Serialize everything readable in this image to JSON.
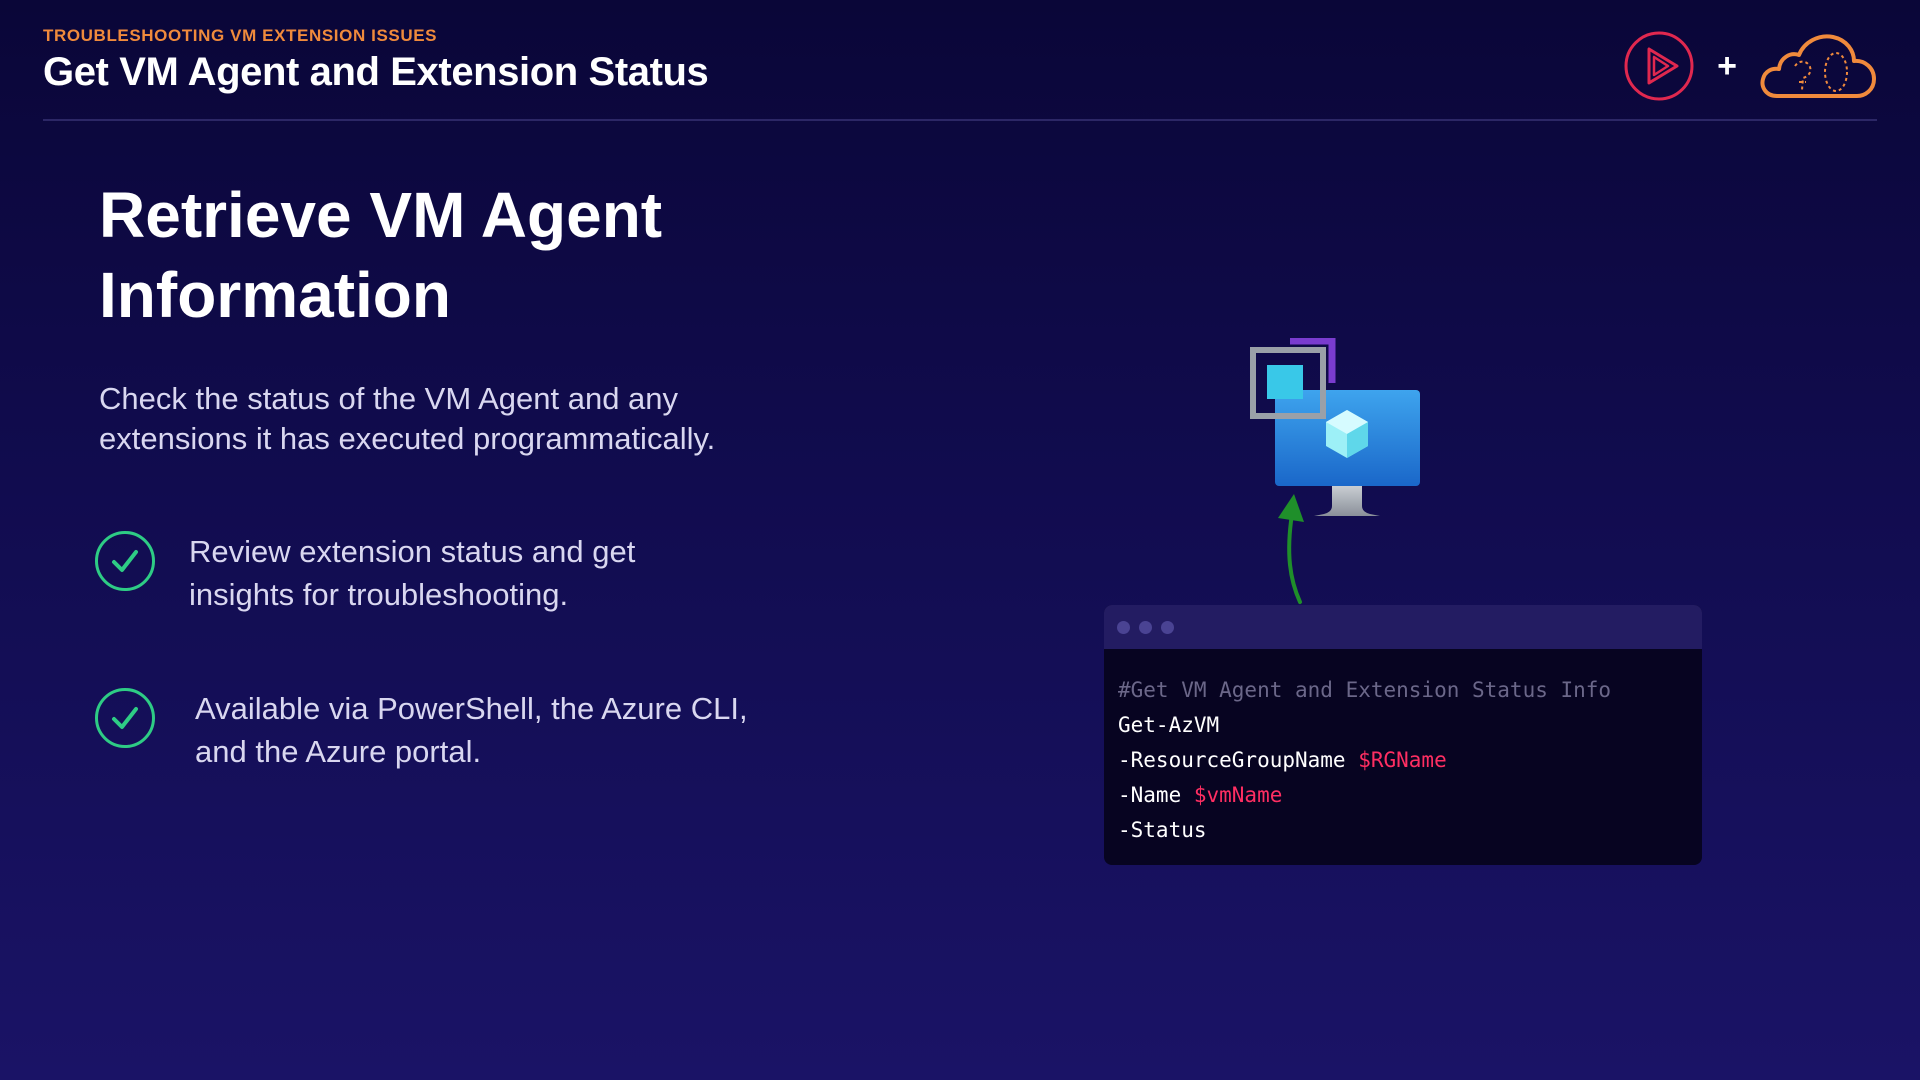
{
  "header": {
    "eyebrow": "TROUBLESHOOTING VM EXTENSION ISSUES",
    "title": "Get VM Agent and Extension Status",
    "plus": "+"
  },
  "main": {
    "headline_line1": "Retrieve VM Agent",
    "headline_line2": "Information",
    "lead": "Check the status of the VM Agent and any extensions it has executed programmatically.",
    "bullets": [
      {
        "text": "Review extension status and get insights for troubleshooting.",
        "icon": "check-circle-icon"
      },
      {
        "text": "Available via PowerShell, the Azure CLI, and the Azure portal.",
        "icon": "check-circle-icon"
      }
    ]
  },
  "terminal": {
    "lines": [
      {
        "text": "#Get VM Agent and Extension Status Info",
        "kind": "comment"
      },
      {
        "text": "Get-AzVM",
        "kind": "command"
      },
      {
        "param": "-ResourceGroupName ",
        "value": "$RGName"
      },
      {
        "param": "-Name ",
        "value": "$vmName"
      },
      {
        "text": "-Status",
        "kind": "param"
      }
    ]
  },
  "colors": {
    "accent_orange": "#f08a3c",
    "check_green": "#2ecc85",
    "code_variable": "#ff2e62",
    "brand_red": "#e0284f"
  },
  "icons": {
    "brand_play": "play-triangle-icon",
    "brand_cloud": "cloud-logo-icon",
    "vm": "virtual-machine-icon",
    "arrow": "arrow-up-icon"
  }
}
